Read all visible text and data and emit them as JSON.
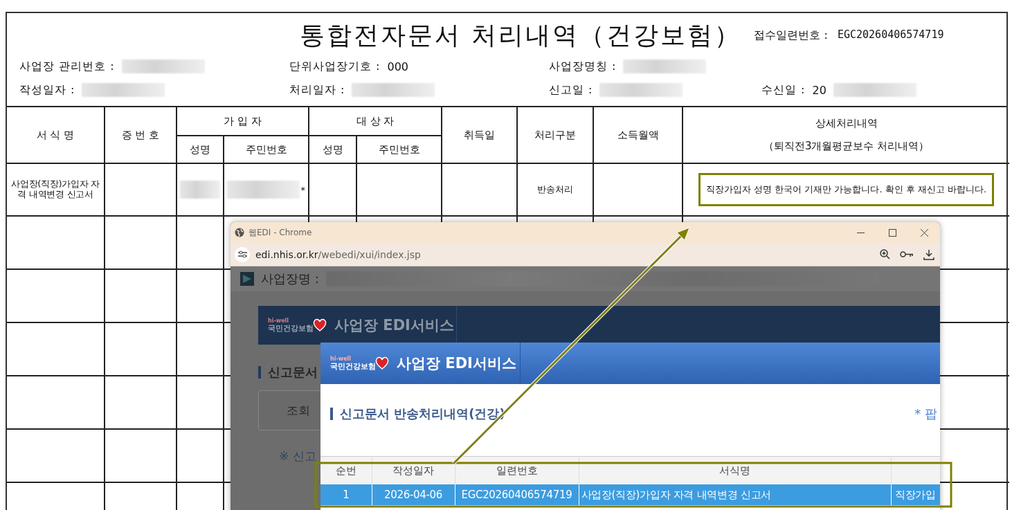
{
  "document": {
    "title": "통합전자문서 처리내역（건강보험）",
    "receipt_label": "접수일련번호 :",
    "receipt_number": "EGC20260406574719",
    "info_rows": [
      [
        {
          "label": "사업장 관리번호 :",
          "redacted": true
        },
        {
          "label": "단위사업장기호 :",
          "value": "000"
        },
        {
          "label": "사업장명칭 :",
          "redacted": true
        }
      ],
      [
        {
          "label": "작성일자 :",
          "redacted": true
        },
        {
          "label": "처리일자 :",
          "redacted": true
        },
        {
          "label": "신고일 :",
          "redacted": true
        },
        {
          "label": "수신일 :",
          "value": "20",
          "redacted": true
        }
      ]
    ],
    "table": {
      "column_groups": [
        {
          "label": "가 입 자"
        },
        {
          "label": "대 상 자"
        }
      ],
      "columns": [
        {
          "label": "서 식 명"
        },
        {
          "label": "증 번 호"
        },
        {
          "label": "성명",
          "grouped": true,
          "group_start": true
        },
        {
          "label": "주민번호",
          "grouped": true
        },
        {
          "label": "성명",
          "grouped": true,
          "group_start": true
        },
        {
          "label": "주민번호",
          "grouped": true
        },
        {
          "label": "취득일"
        },
        {
          "label": "처리구분"
        },
        {
          "label": "소득월액"
        },
        {
          "label": "상세처리내역",
          "sublabel": "（퇴직전3개월평균보수 처리내역）"
        }
      ],
      "rows": [
        {
          "cells": [
            {
              "text": "사업장(직장)가입자 자격 내역변경 신고서"
            },
            {
              "text": ""
            },
            {
              "text": "",
              "redacted": true
            },
            {
              "text": "*",
              "redacted": true
            },
            {
              "text": ""
            },
            {
              "text": ""
            },
            {
              "text": ""
            },
            {
              "text": "반송처리"
            },
            {
              "text": ""
            },
            {
              "text": "직장가입자 성명 한국어 기재만 가능합니다. 확인 후 재신고 바랍니다.",
              "highlighted": true
            }
          ]
        }
      ]
    }
  },
  "browser": {
    "title": "웹EDI - Chrome",
    "url_host": "edi.nhis.or.kr",
    "url_path": "/webedi/xui/index.jsp",
    "page": {
      "business_label": "사업장명 :",
      "logo_tag": "hi-well",
      "logo_text": "국민건강보험",
      "service_title": "사업장 EDI서비스",
      "section_title": "신고문서",
      "search_button": "조회",
      "note": "※ 신고"
    },
    "popup": {
      "logo_tag": "hi-well",
      "logo_text": "국민건강보험",
      "service_title": "사업장 EDI서비스",
      "title": "신고문서 반송처리내역(건강)",
      "notice": "* 팝",
      "table": {
        "columns": [
          "순번",
          "작성일자",
          "일련번호",
          "서식명"
        ],
        "rows": [
          {
            "selected": true,
            "highlighted": true,
            "cells": [
              "1",
              "2026-04-06",
              "EGC20260406574719",
              "사업장(직장)가입자 자격 내역변경 신고서",
              "직장가입"
            ]
          }
        ]
      }
    }
  }
}
